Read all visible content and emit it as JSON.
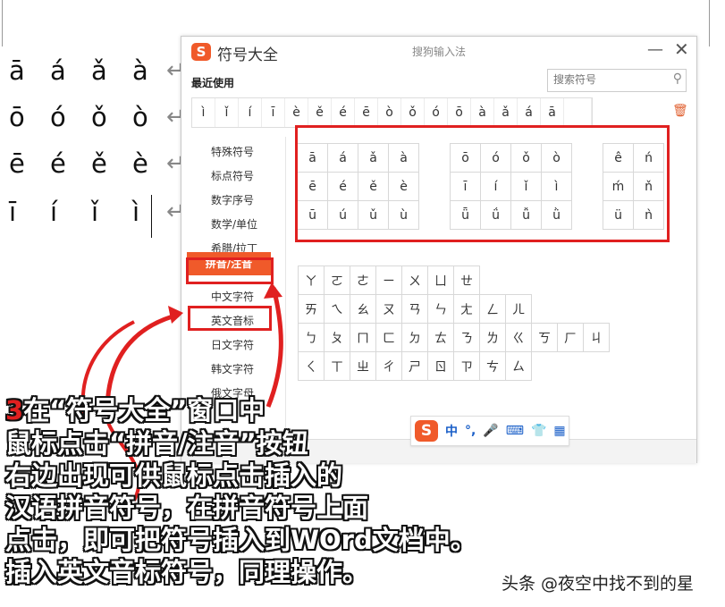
{
  "document": {
    "rows": [
      [
        "ā",
        "á",
        "ǎ",
        "à"
      ],
      [
        "ō",
        "ó",
        "ǒ",
        "ò"
      ],
      [
        "ē",
        "é",
        "ě",
        "è"
      ],
      [
        "ī",
        "í",
        "ǐ",
        "ì"
      ]
    ],
    "return_mark": "↵"
  },
  "dialog": {
    "title": "符号大全",
    "subtitle": "搜狗输入法",
    "logo_letter": "S",
    "minimize_label": "—",
    "close_label": "✕",
    "recent_label": "最近使用",
    "search_placeholder": "搜索符号",
    "recent_symbols": [
      "ì",
      "ǐ",
      "í",
      "ī",
      "è",
      "ě",
      "é",
      "ē",
      "ò",
      "ǒ",
      "ó",
      "ō",
      "à",
      "ǎ",
      "á",
      "ā"
    ],
    "sidebar": [
      {
        "label": "特殊符号"
      },
      {
        "label": "标点符号"
      },
      {
        "label": "数字序号"
      },
      {
        "label": "数学/单位"
      },
      {
        "label": "希腊/拉丁"
      },
      {
        "label": "拼音/注音",
        "active": true
      },
      {
        "label": "中文字符"
      },
      {
        "label": "英文音标"
      },
      {
        "label": "日文字符"
      },
      {
        "label": "韩文字符"
      },
      {
        "label": "俄文字母"
      }
    ],
    "pinyin_a_group": [
      [
        "ā",
        "á",
        "ǎ",
        "à"
      ],
      [
        "ē",
        "é",
        "ě",
        "è"
      ],
      [
        "ū",
        "ú",
        "ǔ",
        "ù"
      ]
    ],
    "pinyin_o_group": [
      [
        "ō",
        "ó",
        "ǒ",
        "ò"
      ],
      [
        "ī",
        "í",
        "ǐ",
        "ì"
      ],
      [
        "ǖ",
        "ǘ",
        "ǚ",
        "ǜ"
      ]
    ],
    "pinyin_e_group": [
      [
        "ê",
        "ń"
      ],
      [
        "ḿ",
        "ň"
      ],
      [
        "ü",
        "ǹ"
      ]
    ],
    "zhuyin_rows": [
      [
        "ㄚ",
        "ㄛ",
        "ㄜ",
        "ㄧ",
        "ㄨ",
        "ㄩ",
        "ㄝ"
      ],
      [
        "ㄞ",
        "ㄟ",
        "ㄠ",
        "ㄡ",
        "ㄢ",
        "ㄣ",
        "ㄤ",
        "ㄥ",
        "ㄦ"
      ],
      [
        "ㄅ",
        "ㄆ",
        "ㄇ",
        "ㄈ",
        "ㄉ",
        "ㄊ",
        "ㄋ",
        "ㄌ",
        "ㄍ",
        "ㄎ",
        "ㄏ",
        "ㄐ"
      ],
      [
        "ㄑ",
        "ㄒ",
        "ㄓ",
        "ㄔ",
        "ㄕ",
        "ㄖ",
        "ㄗ",
        "ㄘ",
        "ㄙ"
      ]
    ]
  },
  "ime_toolbar": {
    "logo_letter": "S",
    "mode_label": "中",
    "punct_label": "°,",
    "mic_label": "🎤",
    "keyboard_label": "⌨",
    "skin_label": "👕",
    "apps_label": "▦"
  },
  "caption": {
    "number": "3",
    "lines": [
      "在“符号大全”窗口中",
      "鼠标点击“拼音/注音”按钮",
      "右边出现可供鼠标点击插入的",
      "汉语拼音符号，在拼音符号上面",
      "点击，即可把符号插入到WOrd文档中。",
      "插入英文音标符号，同理操作。"
    ]
  },
  "watermark": "头条 @夜空中找不到的星",
  "colors": {
    "accent": "#f05a2a",
    "highlight": "#e02020",
    "ime_blue": "#1a5fc8"
  }
}
